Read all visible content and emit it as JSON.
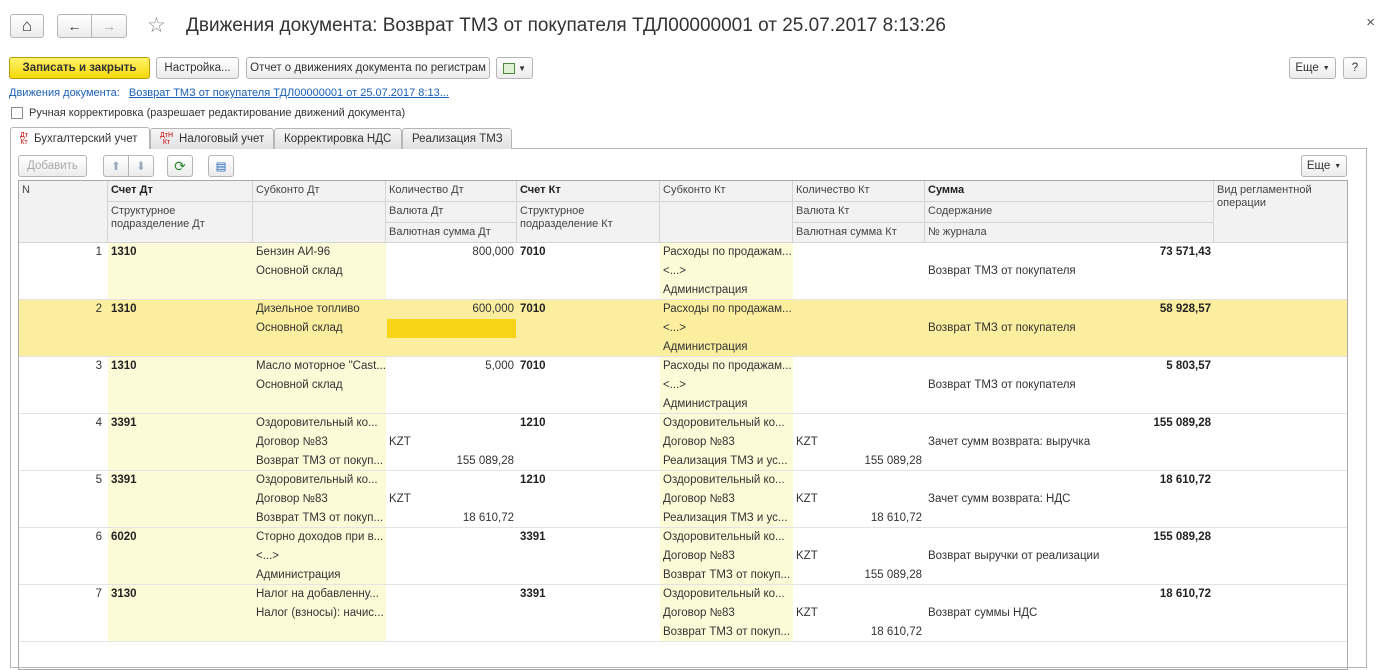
{
  "window": {
    "title": "Движения документа: Возврат ТМЗ от покупателя ТДЛ00000001 от 25.07.2017 8:13:26",
    "close_glyph": "×",
    "home_glyph": "⌂",
    "back_glyph": "←",
    "forward_glyph": "→",
    "star_glyph": "☆"
  },
  "toolbar": {
    "save_close": "Записать и закрыть",
    "settings": "Настройка...",
    "report": "Отчет о движениях документа по регистрам",
    "more": "Еще",
    "help": "?"
  },
  "document": {
    "label": "Движения документа:",
    "link": "Возврат ТМЗ от покупателя ТДЛ00000001 от 25.07.2017 8:13..."
  },
  "manual_correction": {
    "label": "Ручная корректировка (разрешает редактирование движений документа)",
    "checked": false
  },
  "tabs": [
    {
      "label": "Бухгалтерский учет",
      "icon_top": "Дт",
      "icon_bottom": "Кт",
      "active": true
    },
    {
      "label": "Налоговый учет",
      "icon_top": "ДтН",
      "icon_bottom": "Кт",
      "active": false
    },
    {
      "label": "Корректировка НДС",
      "active": false
    },
    {
      "label": "Реализация ТМЗ",
      "active": false
    }
  ],
  "table_toolbar": {
    "add": "Добавить",
    "more": "Еще"
  },
  "columns": {
    "n": "N",
    "account_dt": "Счет Дт",
    "subconto_dt": "Субконто Дт",
    "qty_dt": "Количество Дт",
    "account_kt": "Счет Кт",
    "subconto_kt": "Субконто Кт",
    "qty_kt": "Количество Кт",
    "sum": "Сумма",
    "operation": "Вид регламентной операции",
    "dept_dt": "Структурное подразделение Дт",
    "currency_dt": "Валюта Дт",
    "cur_sum_dt": "Валютная сумма Дт",
    "dept_kt": "Структурное подразделение Кт",
    "currency_kt": "Валюта Кт",
    "cur_sum_kt": "Валютная сумма Кт",
    "content": "Содержание",
    "journal": "№ журнала"
  },
  "rows": [
    {
      "n": "1",
      "dt": "1310",
      "sdt": [
        "Бензин АИ-96",
        "Основной склад",
        ""
      ],
      "qdt": [
        "800,000",
        "",
        ""
      ],
      "kt": "7010",
      "skt": [
        "Расходы по продажам...",
        "<...>",
        "Администрация"
      ],
      "qkt": [
        "",
        "",
        ""
      ],
      "sum": "73 571,43",
      "content": "Возврат ТМЗ от покупателя",
      "journal": ""
    },
    {
      "n": "2",
      "dt": "1310",
      "sdt": [
        "Дизельное топливо",
        "Основной склад",
        ""
      ],
      "qdt": [
        "600,000",
        "",
        ""
      ],
      "kt": "7010",
      "skt": [
        "Расходы по продажам...",
        "<...>",
        "Администрация"
      ],
      "qkt": [
        "",
        "",
        ""
      ],
      "sum": "58 928,57",
      "content": "Возврат ТМЗ от покупателя",
      "journal": "",
      "selected": true
    },
    {
      "n": "3",
      "dt": "1310",
      "sdt": [
        "Масло моторное \"Cast...",
        "Основной склад",
        ""
      ],
      "qdt": [
        "5,000",
        "",
        ""
      ],
      "kt": "7010",
      "skt": [
        "Расходы по продажам...",
        "<...>",
        "Администрация"
      ],
      "qkt": [
        "",
        "",
        ""
      ],
      "sum": "5 803,57",
      "content": "Возврат ТМЗ от покупателя",
      "journal": ""
    },
    {
      "n": "4",
      "dt": "3391",
      "sdt": [
        "Оздоровительный ко...",
        "Договор №83",
        "Возврат ТМЗ от покуп..."
      ],
      "qdt": [
        "",
        "KZT",
        "155 089,28"
      ],
      "kt": "1210",
      "skt": [
        "Оздоровительный ко...",
        "Договор №83",
        "Реализация ТМЗ и ус..."
      ],
      "qkt": [
        "",
        "KZT",
        "155 089,28"
      ],
      "sum": "155 089,28",
      "content": "Зачет сумм возврата: выручка",
      "journal": ""
    },
    {
      "n": "5",
      "dt": "3391",
      "sdt": [
        "Оздоровительный ко...",
        "Договор №83",
        "Возврат ТМЗ от покуп..."
      ],
      "qdt": [
        "",
        "KZT",
        "18 610,72"
      ],
      "kt": "1210",
      "skt": [
        "Оздоровительный ко...",
        "Договор №83",
        "Реализация ТМЗ и ус..."
      ],
      "qkt": [
        "",
        "KZT",
        "18 610,72"
      ],
      "sum": "18 610,72",
      "content": "Зачет сумм возврата: НДС",
      "journal": ""
    },
    {
      "n": "6",
      "dt": "6020",
      "sdt": [
        "Сторно доходов при в...",
        "<...>",
        "Администрация"
      ],
      "qdt": [
        "",
        "",
        ""
      ],
      "kt": "3391",
      "skt": [
        "Оздоровительный ко...",
        "Договор №83",
        "Возврат ТМЗ от покуп..."
      ],
      "qkt": [
        "",
        "KZT",
        "155 089,28"
      ],
      "sum": "155 089,28",
      "content": "Возврат выручки от реализации",
      "journal": ""
    },
    {
      "n": "7",
      "dt": "3130",
      "sdt": [
        "Налог на добавленну...",
        "Налог (взносы): начис...",
        ""
      ],
      "qdt": [
        "",
        "",
        ""
      ],
      "kt": "3391",
      "skt": [
        "Оздоровительный ко...",
        "Договор №83",
        "Возврат ТМЗ от покуп..."
      ],
      "qkt": [
        "",
        "KZT",
        "18 610,72"
      ],
      "sum": "18 610,72",
      "content": "Возврат суммы НДС",
      "journal": ""
    }
  ],
  "colors": {
    "primary_button": "#f5d90a",
    "selected_row": "#fbef9f",
    "focus_cell": "#f7d417",
    "link": "#1a5fb4"
  }
}
